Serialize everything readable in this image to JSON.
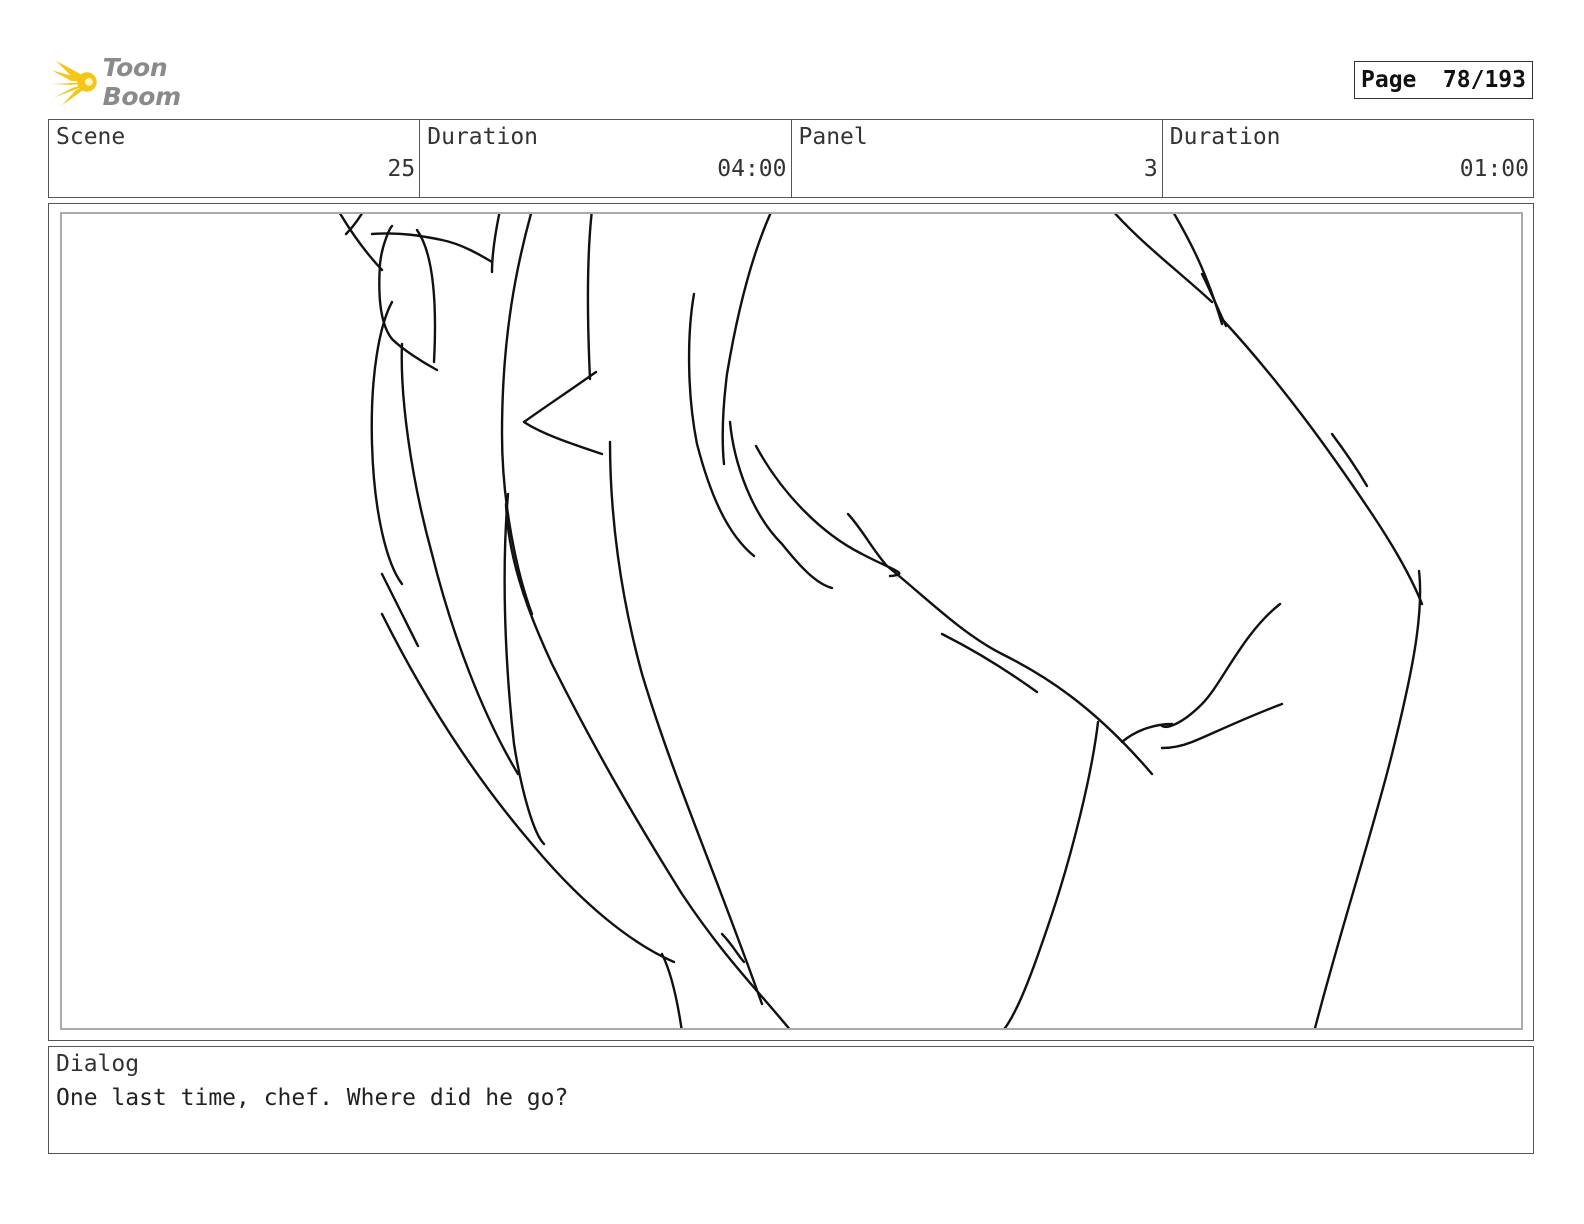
{
  "header": {
    "logo_text": "Toon Boom",
    "page_label": "Page",
    "page_value": "78/193"
  },
  "info": {
    "scene_label": "Scene",
    "scene_value": "25",
    "scene_duration_label": "Duration",
    "scene_duration_value": "04:00",
    "panel_label": "Panel",
    "panel_value": "3",
    "panel_duration_label": "Duration",
    "panel_duration_value": "01:00"
  },
  "dialog": {
    "label": "Dialog",
    "text": "One last time, chef. Where did he go?"
  },
  "colors": {
    "logo_yellow": "#f5c518",
    "logo_text": "#8a8a8a",
    "border": "#555555",
    "inner_border": "#aaaaaa"
  }
}
